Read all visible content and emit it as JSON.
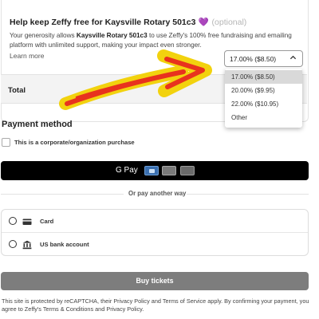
{
  "tip": {
    "title": "Help keep Zeffy free for Kaysville Rotary 501c3",
    "heart": "💜",
    "optional": "(optional)",
    "desc_pre": "Your generosity allows ",
    "desc_org": "Kaysville Rotary 501c3",
    "desc_post": " to use Zeffy's 100% free fundraising and emailing platform with unlimited support, making your impact even stronger.",
    "learn_more": "Learn more",
    "selected_value": "17.00% ($8.50)",
    "options": [
      "17.00% ($8.50)",
      "20.00% ($9.95)",
      "22.00% ($10.95)",
      "Other"
    ]
  },
  "total": {
    "label": "Total"
  },
  "payment": {
    "heading": "Payment method",
    "corporate_label": "This is a corporate/organization purchase",
    "gpay_label": "G Pay",
    "divider_text": "Or pay another way",
    "options": [
      {
        "label": "Card",
        "icon": "credit-card-icon"
      },
      {
        "label": "US bank account",
        "icon": "bank-icon"
      }
    ]
  },
  "buy": {
    "label": "Buy tickets"
  },
  "legal": {
    "t1": "This site is protected by reCAPTCHA, their ",
    "privacy1": "Privacy Policy",
    "t2": " and ",
    "terms1": "Terms of Service",
    "t3": " apply. By confirming your payment, you agree to Zeffy's ",
    "terms2": "Terms & Conditions",
    "t4": " and ",
    "privacy2": "Privacy Policy",
    "t5": "."
  },
  "colors": {
    "arrow_outline": "#f2d20e",
    "arrow_fill": "#e8321e",
    "gpay_bg": "#000000",
    "buy_bg": "#7d7d7d",
    "heart": "#8e44ad"
  }
}
